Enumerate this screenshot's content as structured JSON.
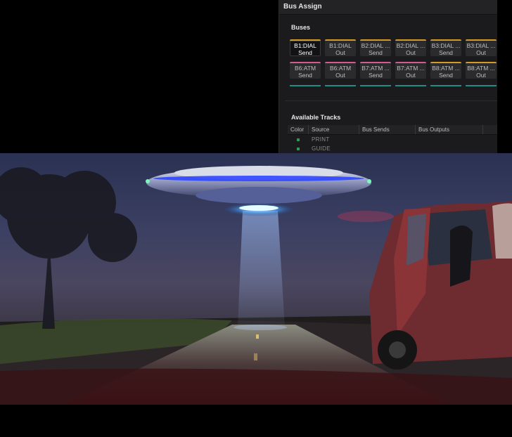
{
  "panel": {
    "title": "Bus Assign",
    "buses_heading": "Buses",
    "available_tracks_heading": "Available Tracks"
  },
  "buses": [
    {
      "line1": "B1:DIAL",
      "line2": "Send",
      "color": "#d49a2a",
      "active": true
    },
    {
      "line1": "B1:DIAL",
      "line2": "Out",
      "color": "#d49a2a",
      "active": false
    },
    {
      "line1": "B2:DIAL ...",
      "line2": "Send",
      "color": "#d49a2a",
      "active": false
    },
    {
      "line1": "B2:DIAL ...",
      "line2": "Out",
      "color": "#d49a2a",
      "active": false
    },
    {
      "line1": "B3:DIAL ...",
      "line2": "Send",
      "color": "#d49a2a",
      "active": false
    },
    {
      "line1": "B3:DIAL ...",
      "line2": "Out",
      "color": "#d49a2a",
      "active": false
    },
    {
      "line1": "B6:ATM",
      "line2": "Send",
      "color": "#d25c8f",
      "active": false
    },
    {
      "line1": "B6:ATM",
      "line2": "Out",
      "color": "#d25c8f",
      "active": false
    },
    {
      "line1": "B7:ATM ...",
      "line2": "Send",
      "color": "#d25c8f",
      "active": false
    },
    {
      "line1": "B7:ATM ...",
      "line2": "Out",
      "color": "#d25c8f",
      "active": false
    },
    {
      "line1": "B8:ATM ...",
      "line2": "Send",
      "color": "#d49a2a",
      "active": false
    },
    {
      "line1": "B8:ATM ...",
      "line2": "Out",
      "color": "#d49a2a",
      "active": false
    }
  ],
  "tracks_table": {
    "columns": [
      "Color",
      "Source",
      "Bus Sends",
      "Bus Outputs"
    ],
    "rows": [
      {
        "color": "#2f9a58",
        "source": "PRINT"
      },
      {
        "color": "#2f9a58",
        "source": "GUIDE"
      }
    ]
  },
  "viewer": {
    "image_label": "ufo-scene-frame"
  }
}
